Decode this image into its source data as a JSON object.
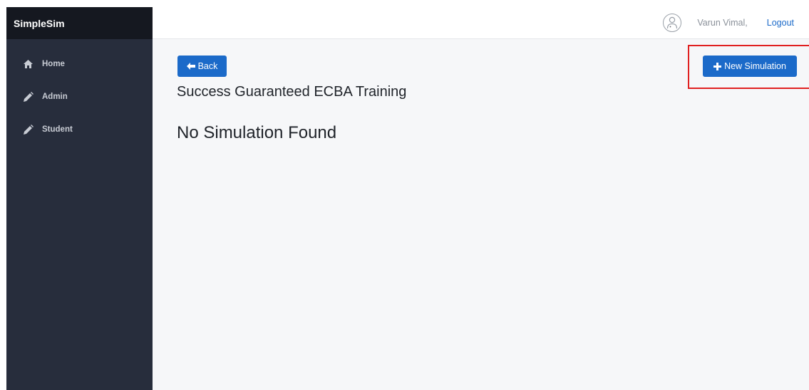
{
  "app": {
    "brand": "SimpleSim"
  },
  "sidebar": {
    "items": [
      {
        "label": "Home",
        "icon": "home-icon"
      },
      {
        "label": "Admin",
        "icon": "pencil-icon"
      },
      {
        "label": "Student",
        "icon": "pencil-icon"
      }
    ]
  },
  "header": {
    "user_name": "Varun Vimal,",
    "logout_label": "Logout",
    "avatar_icon": "user-avatar-icon"
  },
  "main": {
    "back_label": "Back",
    "back_icon": "arrow-left-icon",
    "new_simulation_label": "New Simulation",
    "new_simulation_icon": "plus-icon",
    "page_title": "Success Guaranteed ECBA Training",
    "empty_message": "No Simulation Found"
  },
  "colors": {
    "sidebar_bg": "#272d3c",
    "brand_bg": "#151820",
    "accent": "#1b6ac9",
    "highlight": "#e02020",
    "content_bg": "#f6f7f9"
  }
}
